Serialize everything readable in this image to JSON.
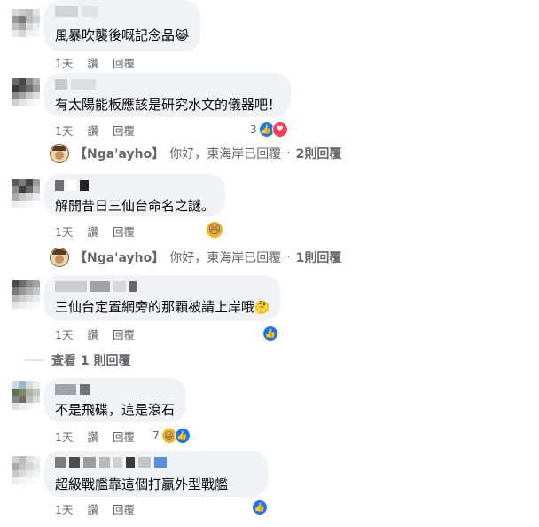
{
  "comments": [
    {
      "text": "風暴吹襲後嘅記念品",
      "emoji": "😹",
      "time": "1天",
      "like": "讚",
      "reply": "回覆"
    },
    {
      "text": "有太陽能板應該是研究水文的儀器吧！",
      "time": "1天",
      "like": "讚",
      "reply": "回覆",
      "reaction_count": "3",
      "page_reply": {
        "name": "【Nga'ayho】",
        "text": "你好，東海岸已回覆",
        "sep": "·",
        "count": "2則回覆"
      }
    },
    {
      "text": "解開昔日三仙台命名之謎。",
      "time": "1天",
      "like": "讚",
      "reply": "回覆",
      "page_reply": {
        "name": "【Nga'ayho】",
        "text": "你好，東海岸已回覆",
        "sep": "·",
        "count": "1則回覆"
      }
    },
    {
      "text": "三仙台定置網旁的那顆被請上岸哦",
      "emoji": "🤔",
      "time": "1天",
      "like": "讚",
      "reply": "回覆",
      "view_more": "查看 1 則回覆"
    },
    {
      "text": "不是飛碟，這是滾石",
      "time": "1天",
      "like": "讚",
      "reply": "回覆",
      "reaction_count": "7"
    },
    {
      "text": "超級戰艦靠這個打贏外型戰艦",
      "time": "1天",
      "like": "讚",
      "reply": "回覆"
    }
  ],
  "icons": {
    "like": "like-icon",
    "love": "love-icon",
    "haha": "haha-icon"
  },
  "colors": {
    "bubble": "#f0f2f5",
    "meta_text": "#65676b",
    "like_blue": "#1877f2",
    "love_red": "#f33e58",
    "haha_yellow": "#f7b125"
  }
}
